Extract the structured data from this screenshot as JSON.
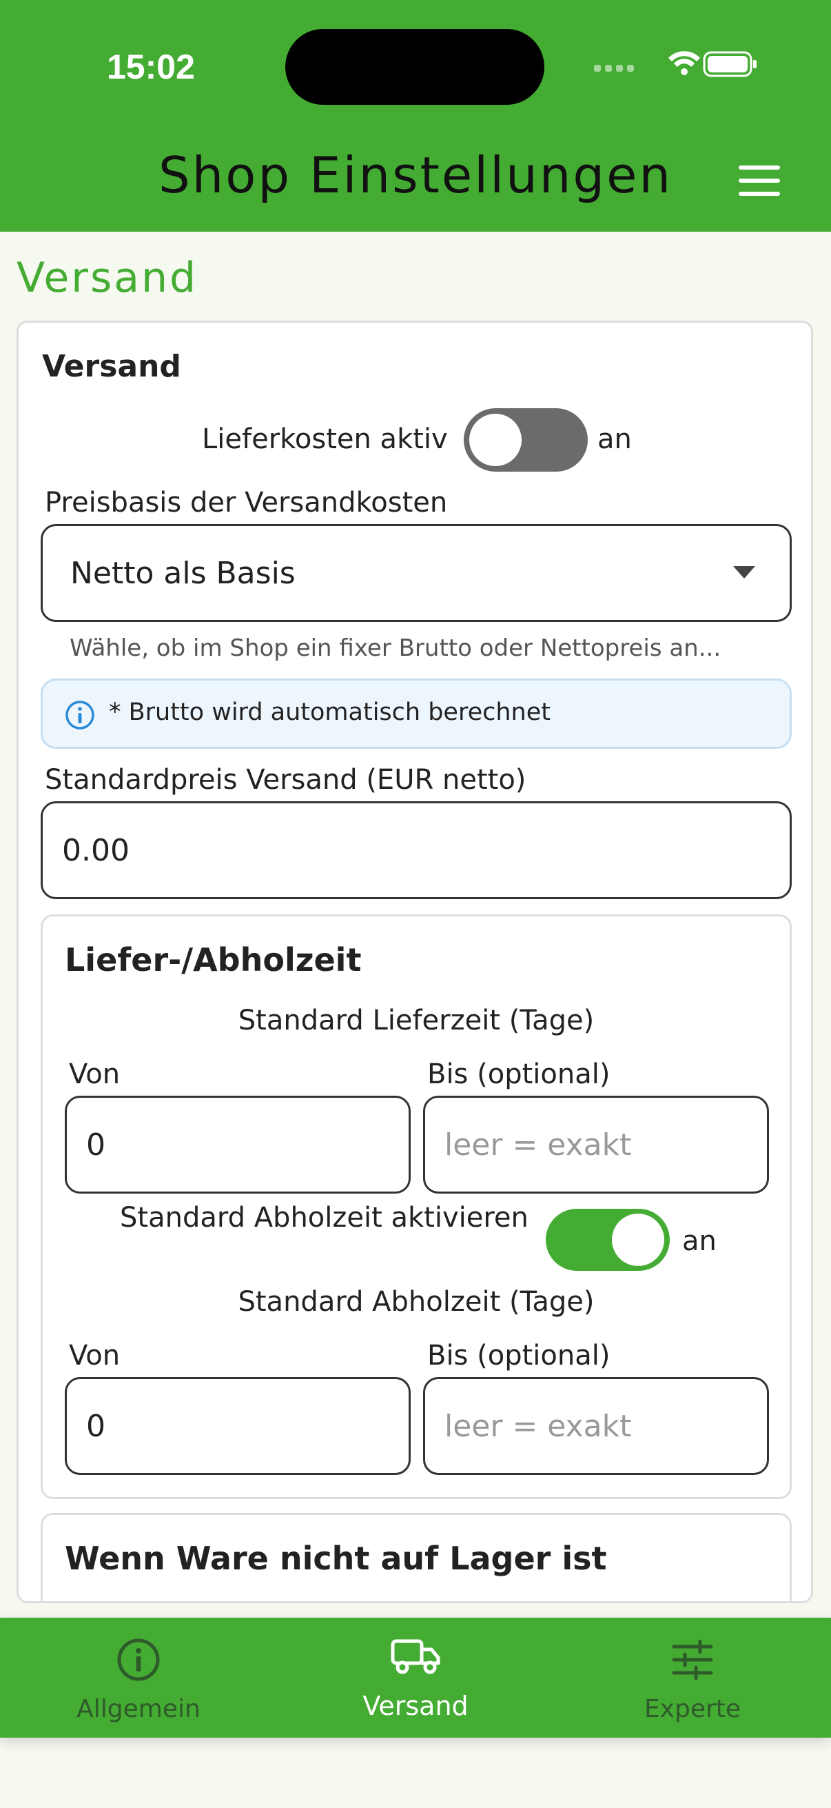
{
  "status_bar": {
    "time": "15:02"
  },
  "header": {
    "title": "Shop Einstellungen",
    "menu_icon": "hamburger-menu-icon"
  },
  "section": {
    "title": "Versand"
  },
  "card": {
    "title": "Versand",
    "shipping_toggle": {
      "label": "Lieferkosten aktiv",
      "state_label": "an",
      "on": false
    },
    "price_basis": {
      "label": "Preisbasis der Versandkosten",
      "selected": "Netto als Basis",
      "helper": "Wähle, ob im Shop ein fixer Brutto oder Nettopreis an..."
    },
    "info": {
      "text": "* Brutto wird automatisch berechnet",
      "icon": "info-icon"
    },
    "standard_price": {
      "label": "Standardpreis Versand (EUR netto)",
      "value": "0.00"
    },
    "delivery": {
      "title": "Liefer-/Abholzeit",
      "delivery_time": {
        "label": "Standard Lieferzeit (Tage)",
        "from_label": "Von",
        "from_value": "0",
        "to_label": "Bis (optional)",
        "to_placeholder": "leer = exakt"
      },
      "pickup_toggle": {
        "label": "Standard Abholzeit aktivieren",
        "state_label": "an",
        "on": true
      },
      "pickup_time": {
        "label": "Standard Abholzeit (Tage)",
        "from_label": "Von",
        "from_value": "0",
        "to_label": "Bis (optional)",
        "to_placeholder": "leer = exakt"
      }
    },
    "out_of_stock": {
      "title": "Wenn Ware nicht auf Lager ist"
    }
  },
  "bottom_nav": {
    "items": [
      {
        "label": "Allgemein",
        "icon": "info-circle-icon",
        "active": false
      },
      {
        "label": "Versand",
        "icon": "truck-icon",
        "active": true
      },
      {
        "label": "Experte",
        "icon": "sliders-icon",
        "active": false
      }
    ]
  },
  "colors": {
    "brand_green": "#44ac33",
    "inactive_nav": "#2f5a2a",
    "toggle_off": "#6b6b6b",
    "info_blue": "#2b8ad6"
  }
}
